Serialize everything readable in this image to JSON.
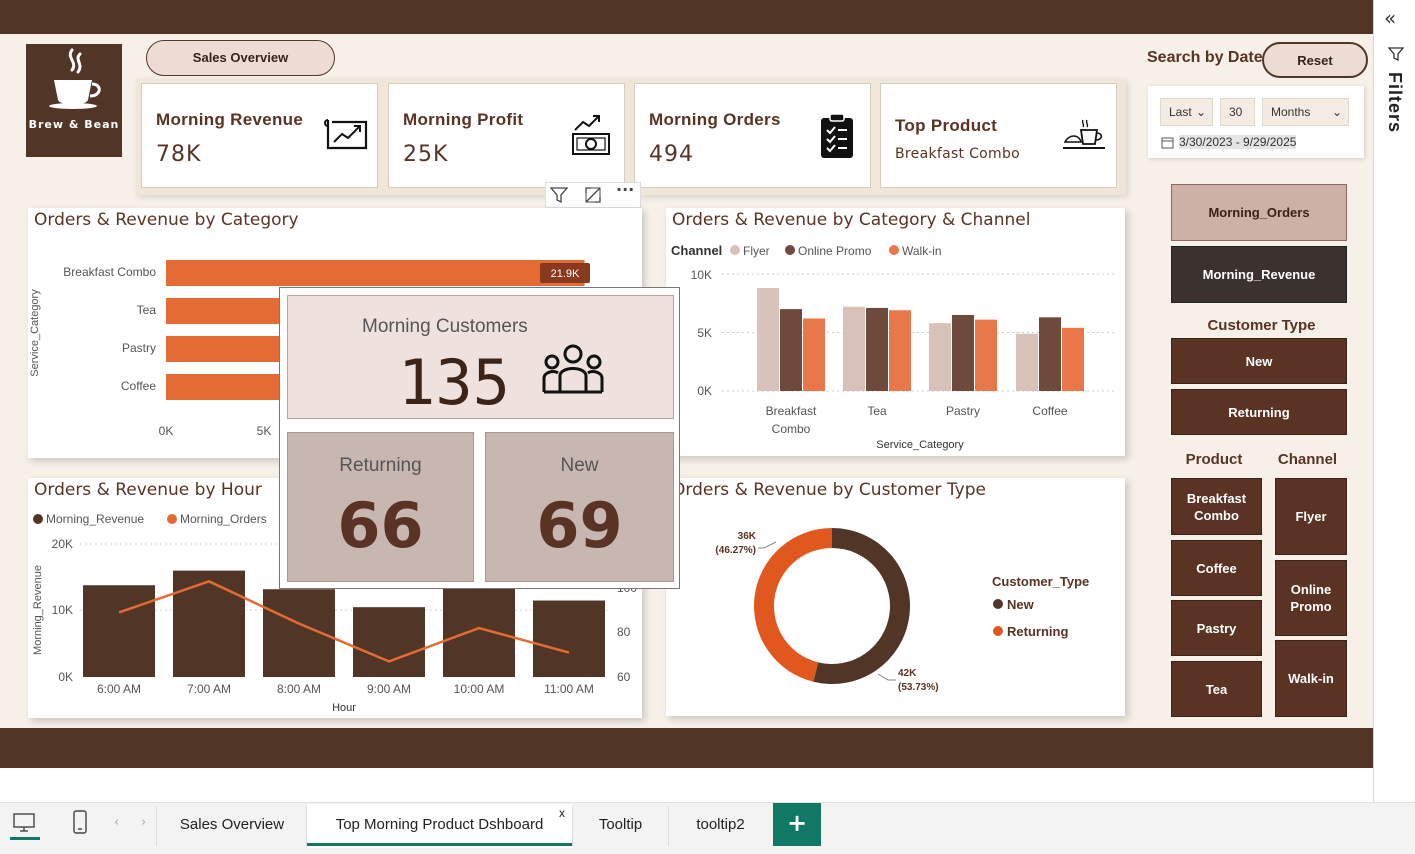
{
  "logo": {
    "text": "Brew & Bean"
  },
  "nav": {
    "sales_overview": "Sales Overview"
  },
  "kpis": [
    {
      "title": "Morning Revenue",
      "value": "78K",
      "icon": "chart-icon"
    },
    {
      "title": "Morning Profit",
      "value": "25K",
      "icon": "profit-growth-icon"
    },
    {
      "title": "Morning Orders",
      "value": "494",
      "icon": "clipboard-icon"
    },
    {
      "title": "Top Product",
      "value": "Breakfast Combo",
      "icon": "breakfast-icon"
    }
  ],
  "date_filter": {
    "label": "Search by Date",
    "reset": "Reset",
    "relative": "Last",
    "amount": "30",
    "unit": "Months",
    "range": "3/30/2023 - 9/29/2025"
  },
  "visual_header_icons": [
    "filter-icon",
    "focus-mode-icon",
    "more-options-icon"
  ],
  "measure_buttons": [
    "Morning_Orders",
    "Morning_Revenue"
  ],
  "slicers": {
    "customer_type_title": "Customer Type",
    "customer_type": [
      "New",
      "Returning"
    ],
    "product_title": "Product",
    "products": [
      "Breakfast Combo",
      "Coffee",
      "Pastry",
      "Tea"
    ],
    "channel_title": "Channel",
    "channels": [
      "Flyer",
      "Online Promo",
      "Walk-in"
    ]
  },
  "tooltip": {
    "title": "Morning Customers",
    "total": "135",
    "returning_label": "Returning",
    "returning_value": "66",
    "new_label": "New",
    "new_value": "69"
  },
  "charts_text": {
    "cat_title": "Orders & Revenue by Category",
    "cat_ylabel": "Service_Category",
    "cat_data_label": "21.9K",
    "cat_ticks": [
      "0K",
      "5K"
    ],
    "channel_title": "Orders & Revenue by Category & Channel",
    "channel_legend_title": "Channel",
    "channel_xlabel": "Service_Category",
    "channel_yticks": [
      "10K",
      "5K",
      "0K"
    ],
    "channel_cat_labels": [
      "Breakfast",
      "Combo",
      "Tea",
      "Pastry",
      "Coffee"
    ],
    "hour_title": "Orders & Revenue by Hour",
    "hour_legend": [
      "Morning_Revenue",
      "Morning_Orders"
    ],
    "hour_ylabel": "Morning_Revenue",
    "hour_xlabel": "Hour",
    "hour_left_ticks": [
      "20K",
      "10K",
      "0K"
    ],
    "hour_right_ticks": [
      "100",
      "80",
      "60"
    ],
    "cust_title": "Orders & Revenue by Customer Type",
    "cust_legend_title": "Customer_Type",
    "cust_label_new": "42K",
    "cust_pct_new": "(53.73%)",
    "cust_label_ret": "36K",
    "cust_pct_ret": "(46.27%)"
  },
  "chart_data": [
    {
      "type": "bar",
      "title": "Orders & Revenue by Category",
      "orientation": "horizontal",
      "categories": [
        "Breakfast Combo",
        "Tea",
        "Pastry",
        "Coffee"
      ],
      "values": [
        21900,
        20000,
        19500,
        19000
      ],
      "ylabel": "Service_Category",
      "xlim": [
        0,
        22500
      ],
      "color": "#e46b34"
    },
    {
      "type": "bar",
      "title": "Orders & Revenue by Category & Channel",
      "categories": [
        "Breakfast Combo",
        "Tea",
        "Pastry",
        "Coffee"
      ],
      "series": [
        {
          "name": "Flyer",
          "values": [
            8800,
            7200,
            5800,
            4900
          ],
          "color": "#d8c1b8"
        },
        {
          "name": "Online Promo",
          "values": [
            7000,
            7100,
            6500,
            6300
          ],
          "color": "#6e4a3c"
        },
        {
          "name": "Walk-in",
          "values": [
            6200,
            6900,
            6100,
            5400
          ],
          "color": "#e8784a"
        }
      ],
      "xlabel": "Service_Category",
      "ylim": [
        0,
        10000
      ]
    },
    {
      "type": "bar",
      "title": "Orders & Revenue by Hour",
      "categories": [
        "6:00 AM",
        "7:00 AM",
        "8:00 AM",
        "9:00 AM",
        "10:00 AM",
        "11:00 AM"
      ],
      "series": [
        {
          "name": "Morning_Revenue",
          "values": [
            13800,
            16000,
            13200,
            10500,
            13500,
            11500
          ],
          "color": "#513628",
          "axis": "left"
        },
        {
          "name": "Morning_Orders",
          "values": [
            89,
            103,
            84,
            67,
            82,
            71
          ],
          "color": "#e46b34",
          "axis": "right",
          "type": "line"
        }
      ],
      "xlabel": "Hour",
      "ylabel": "Morning_Revenue",
      "ylim": [
        0,
        20000
      ],
      "y2lim": [
        60,
        100
      ]
    },
    {
      "type": "pie",
      "title": "Orders & Revenue by Customer Type",
      "categories": [
        "New",
        "Returning"
      ],
      "values": [
        42000,
        36000
      ],
      "percent": [
        53.73,
        46.27
      ],
      "colors": [
        "#513628",
        "#e0581e"
      ]
    }
  ],
  "tabs": [
    "Sales Overview",
    "Top Morning Product Dshboard",
    "Tooltip",
    "tooltip2"
  ],
  "filters_pane": {
    "label": "Filters"
  },
  "colors": {
    "brand": "#513628",
    "accent": "#e46b34",
    "background": "#f6f0e8",
    "teal": "#117865"
  }
}
